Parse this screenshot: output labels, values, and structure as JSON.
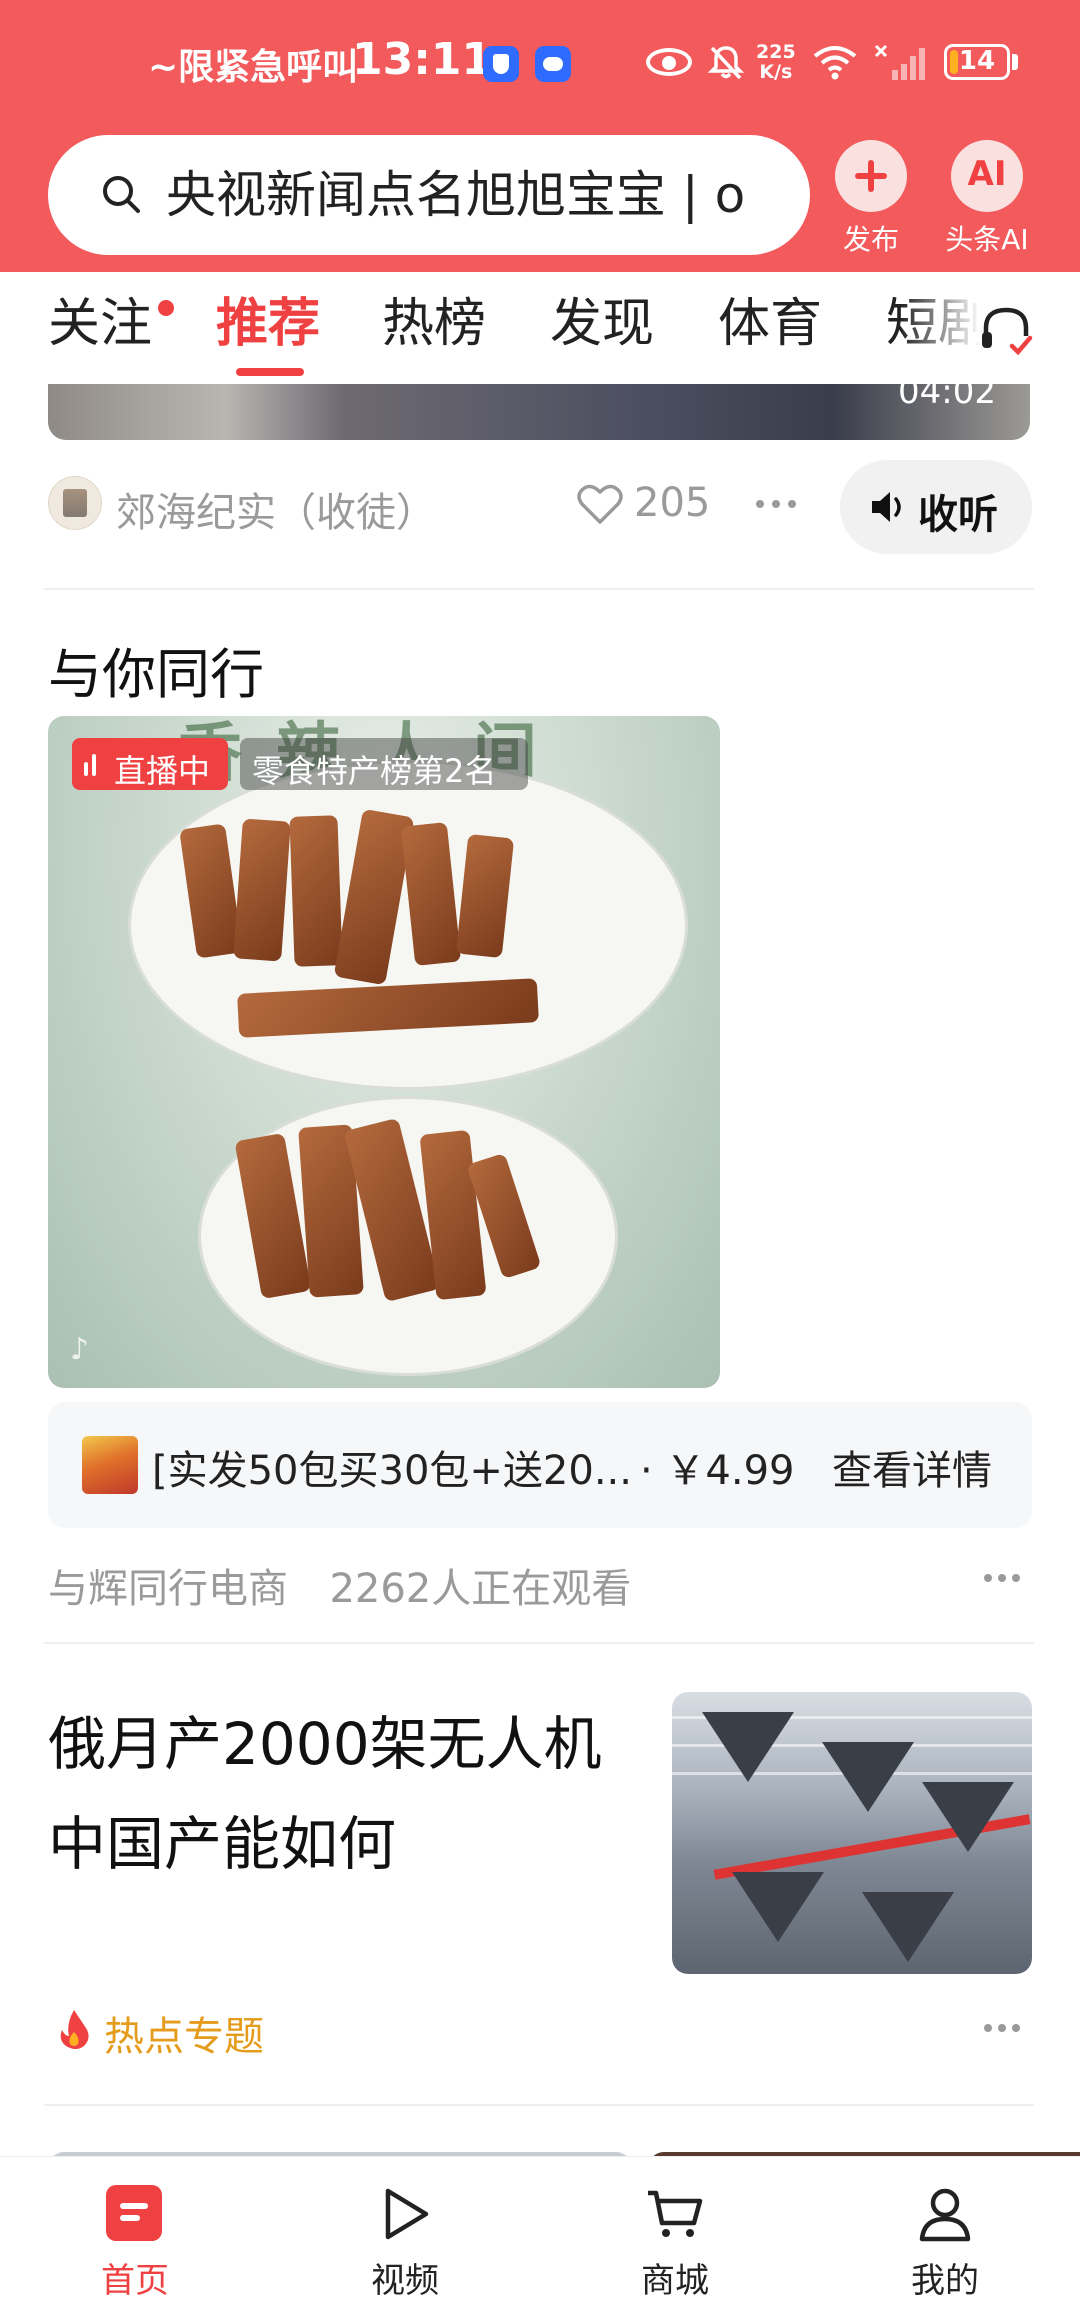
{
  "status_bar": {
    "alert_text": "~限紧急呼叫",
    "time": "13:11",
    "net_speed_value": "225",
    "net_speed_unit": "K/s",
    "battery": "14",
    "battery_level": 0.14,
    "battery_color": "#ffb020"
  },
  "header": {
    "search_text": "央视新闻点名旭旭宝宝 | o",
    "publish_label": "发布",
    "ai_icon_text": "AI",
    "ai_label": "头条AI",
    "accent_color": "#f25a5c"
  },
  "tabs": {
    "items": [
      "关注",
      "推荐",
      "热榜",
      "发现",
      "体育",
      "短剧"
    ],
    "active": "推荐"
  },
  "previous_card": {
    "duration": "04:02",
    "source_name": "郊海纪实（收徒）",
    "likes": "205",
    "listen_label": "收听"
  },
  "live_section": {
    "title": "与你同行",
    "live_badge": "直播中",
    "rank_badge": "零食特产榜第2名",
    "product_title": "[实发50包买30包+送20...",
    "product_price": "· ￥4.99",
    "product_link": "查看详情",
    "streamer": "与辉同行电商",
    "viewers": "2262人正在观看"
  },
  "article": {
    "title_line1": "俄月产2000架无人机",
    "title_line2": "中国产能如何",
    "tag": "热点专题"
  },
  "bottom_nav": {
    "items": [
      "首页",
      "视频",
      "商城",
      "我的"
    ],
    "active": "首页",
    "active_color": "#f04142"
  }
}
